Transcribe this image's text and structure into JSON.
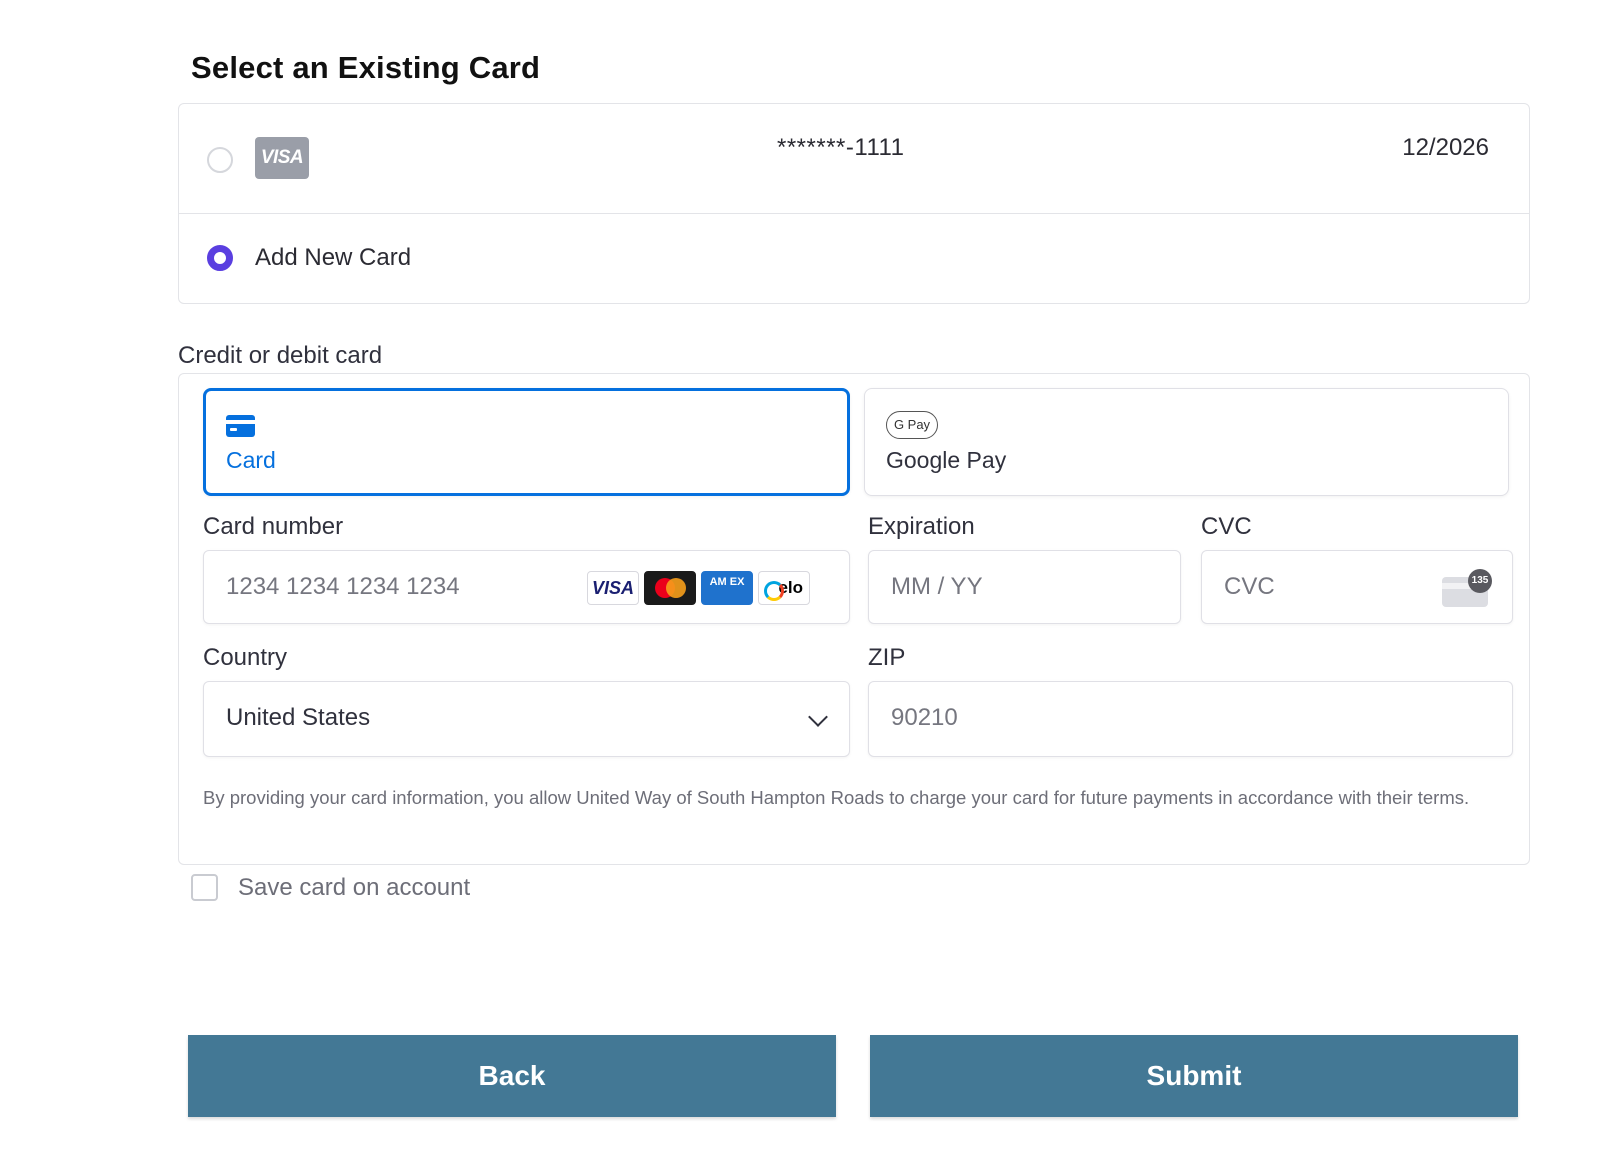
{
  "section_title": "Select an Existing Card",
  "saved_cards": [
    {
      "brand": "VISA",
      "masked_number": "*******-1111",
      "expiry": "12/2026",
      "selected": false
    }
  ],
  "add_new_card": {
    "label": "Add New Card",
    "selected": true
  },
  "payment_form": {
    "heading": "Credit or debit card",
    "tabs": [
      {
        "label": "Card",
        "icon": "credit-card-icon",
        "active": true
      },
      {
        "label": "Google Pay",
        "icon": "google-pay-icon",
        "badge": "G Pay",
        "active": false
      }
    ],
    "card_number": {
      "label": "Card number",
      "placeholder": "1234 1234 1234 1234",
      "brands": [
        "VISA",
        "Mastercard",
        "AMEX",
        "elo"
      ],
      "amex_text": "AM EX",
      "elo_text": "elo"
    },
    "expiration": {
      "label": "Expiration",
      "placeholder": "MM / YY"
    },
    "cvc": {
      "label": "CVC",
      "placeholder": "CVC",
      "icon_badge": "135"
    },
    "country": {
      "label": "Country",
      "value": "United States"
    },
    "zip": {
      "label": "ZIP",
      "placeholder": "90210"
    },
    "disclaimer": "By providing your card information, you allow United Way of South Hampton Roads to charge your card for future payments in accordance with their terms."
  },
  "save_card": {
    "label": "Save card on account",
    "checked": false
  },
  "buttons": {
    "back": "Back",
    "submit": "Submit"
  },
  "colors": {
    "accent_blue": "#0570de",
    "radio_purple": "#5a3fe0",
    "button_bg": "#437895"
  }
}
